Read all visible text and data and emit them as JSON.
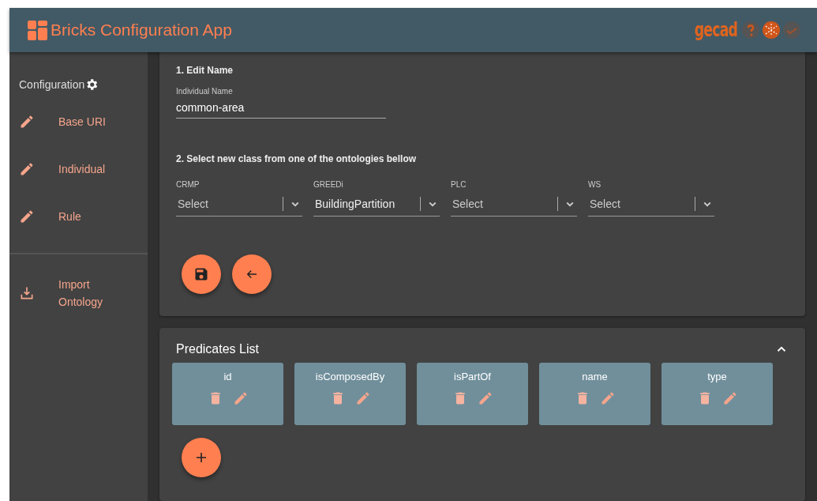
{
  "header": {
    "title": "Bricks Configuration App",
    "logo": "gecad"
  },
  "sidebar": {
    "heading": "Configuration",
    "items": [
      {
        "label": "Base URI",
        "kind": "edit"
      },
      {
        "label": "Individual",
        "kind": "edit"
      },
      {
        "label": "Rule",
        "kind": "edit"
      }
    ],
    "bottom_items": [
      {
        "label": "Import Ontology",
        "kind": "import"
      }
    ]
  },
  "edit_form": {
    "step_1": "1. Edit Name",
    "name_field": {
      "label": "Individual Name",
      "value": "common-area"
    },
    "step_2": "2. Select new class from one of the ontologies bellow",
    "selects": [
      {
        "label": "CRMP",
        "value": "Select",
        "chosen": false
      },
      {
        "label": "GREEDi",
        "value": "BuildingPartition",
        "chosen": true
      },
      {
        "label": "PLC",
        "value": "Select",
        "chosen": false
      },
      {
        "label": "WS",
        "value": "Select",
        "chosen": false
      }
    ]
  },
  "predicates": {
    "title": "Predicates List",
    "expanded": true,
    "items": [
      {
        "name": "id"
      },
      {
        "name": "isComposedBy"
      },
      {
        "name": "isPartOf"
      },
      {
        "name": "name"
      },
      {
        "name": "type"
      }
    ]
  }
}
